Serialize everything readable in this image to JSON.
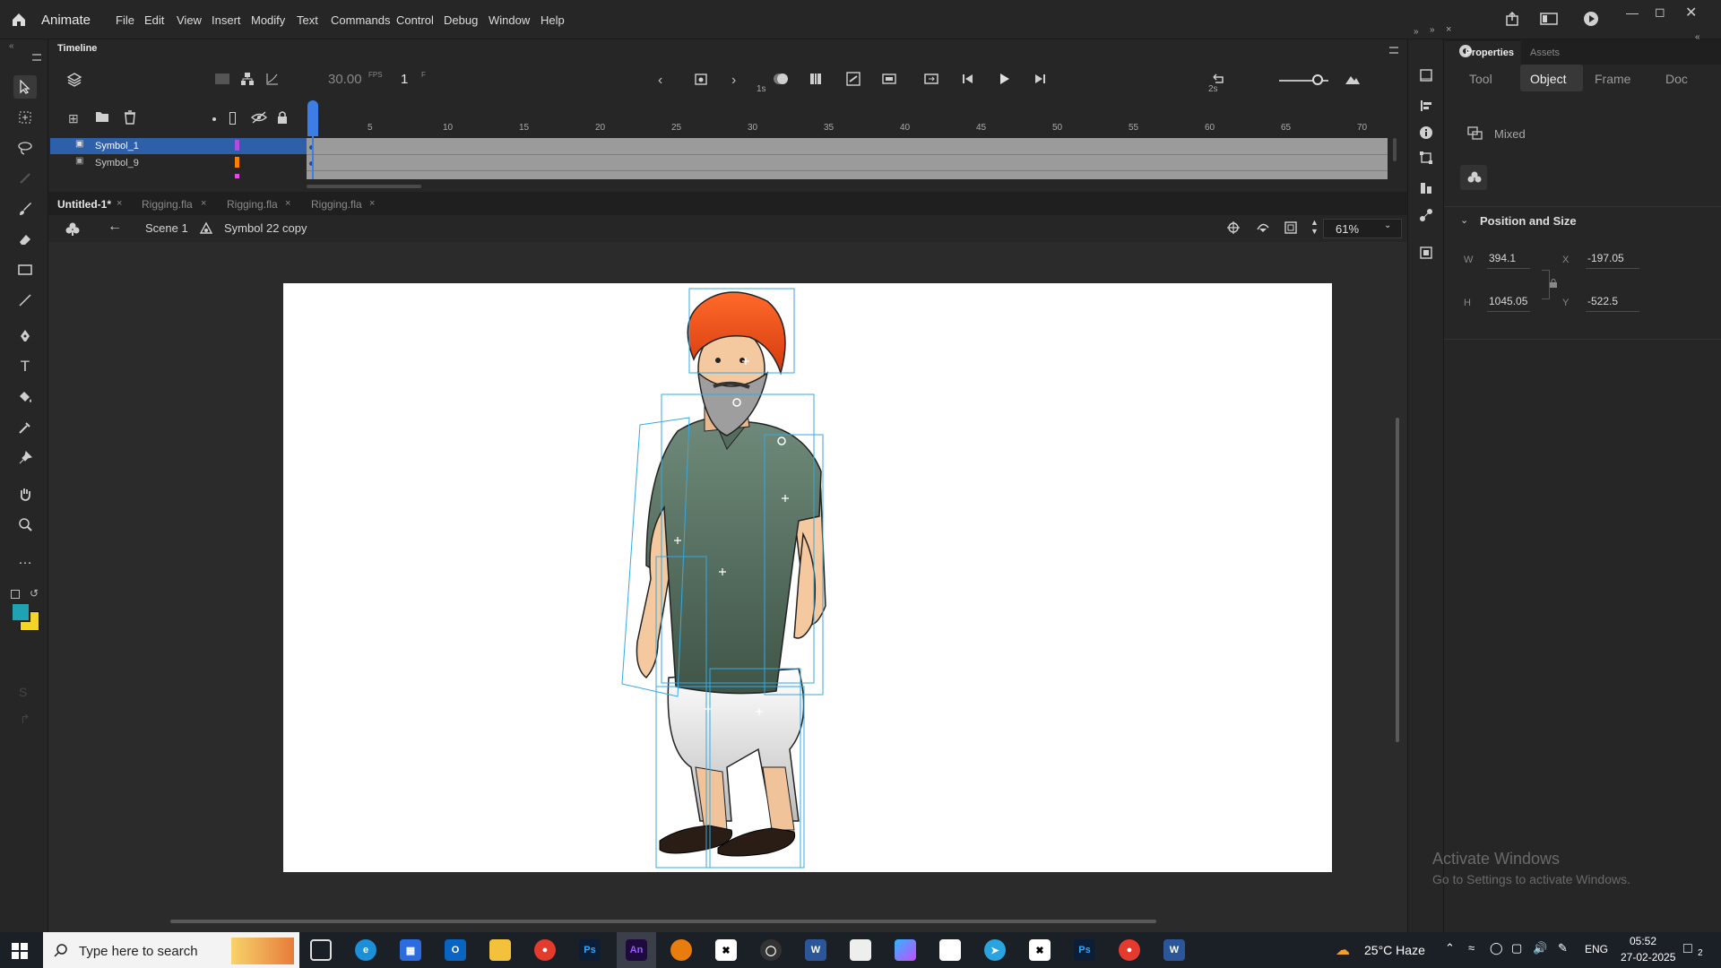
{
  "app": {
    "name": "Animate"
  },
  "menu": [
    "File",
    "Edit",
    "View",
    "Insert",
    "Modify",
    "Text",
    "Commands",
    "Control",
    "Debug",
    "Window",
    "Help"
  ],
  "timeline": {
    "panel_title": "Timeline",
    "fps": "30.00",
    "fps_unit": "FPS",
    "frame": "1",
    "frame_unit": "F",
    "second_marks": [
      "1s",
      "2s"
    ],
    "ruler": [
      "5",
      "10",
      "15",
      "20",
      "25",
      "30",
      "35",
      "40",
      "45",
      "50",
      "55",
      "60",
      "65",
      "70"
    ],
    "layers": [
      {
        "name": "Symbol_1",
        "color": "#b24be0",
        "selected": true
      },
      {
        "name": "Symbol_9",
        "color": "#ff7f00",
        "selected": false
      }
    ]
  },
  "tabs": [
    {
      "label": "Untitled-1*",
      "active": true
    },
    {
      "label": "Rigging.fla",
      "active": false
    },
    {
      "label": "Rigging.fla",
      "active": false
    },
    {
      "label": "Rigging.fla",
      "active": false
    }
  ],
  "editbar": {
    "scene": "Scene 1",
    "symbol": "Symbol 22 copy",
    "zoom": "61%"
  },
  "properties": {
    "panel_tabs": [
      "Properties",
      "Assets"
    ],
    "tabs": [
      "Tool",
      "Object",
      "Frame",
      "Doc"
    ],
    "active_tab": "Object",
    "instance_type": "Mixed",
    "section": "Position and Size",
    "w_label": "W",
    "w": "394.1",
    "h_label": "H",
    "h": "1045.05",
    "x_label": "X",
    "x": "-197.05",
    "y_label": "Y",
    "y": "-522.5"
  },
  "watermark": {
    "title": "Activate Windows",
    "subtitle": "Go to Settings to activate Windows."
  },
  "taskbar": {
    "search_placeholder": "Type here to search",
    "weather": "25°C  Haze",
    "language": "ENG",
    "time": "05:52",
    "date": "27-02-2025",
    "notifications": "2",
    "apps": [
      "task-view",
      "edge",
      "store",
      "outlook",
      "explorer",
      "chrome",
      "photoshop",
      "animate",
      "blender",
      "capcut",
      "obs",
      "word",
      "notepad",
      "copilot",
      "file",
      "telegram",
      "capcut2",
      "photoshop2",
      "chrome2",
      "word2"
    ]
  },
  "colors": {
    "accent": "#2680eb",
    "stroke": "#1ea3b5",
    "fill": "#f4d32a",
    "selection": "#2d60a8"
  }
}
